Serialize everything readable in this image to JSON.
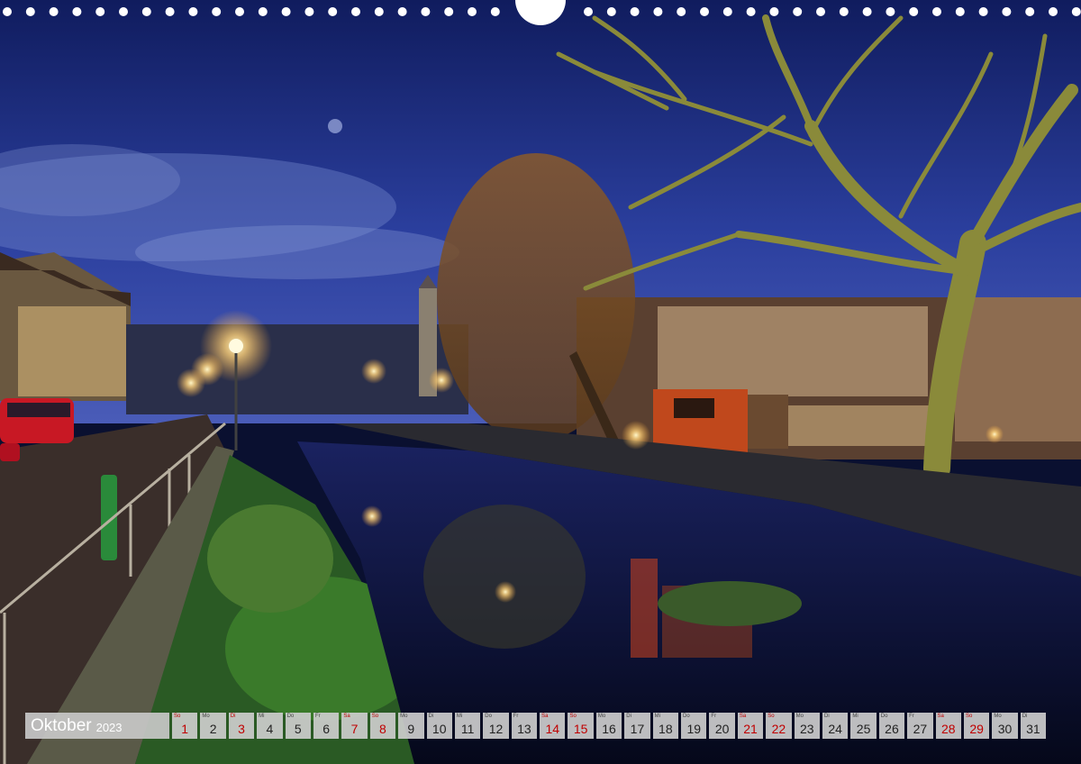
{
  "calendar": {
    "month": "Oktober",
    "year": "2023",
    "days": [
      {
        "wd": "So",
        "num": "1",
        "red": true
      },
      {
        "wd": "Mo",
        "num": "2",
        "red": false
      },
      {
        "wd": "Di",
        "num": "3",
        "red": true
      },
      {
        "wd": "Mi",
        "num": "4",
        "red": false
      },
      {
        "wd": "Do",
        "num": "5",
        "red": false
      },
      {
        "wd": "Fr",
        "num": "6",
        "red": false
      },
      {
        "wd": "Sa",
        "num": "7",
        "red": true
      },
      {
        "wd": "So",
        "num": "8",
        "red": true
      },
      {
        "wd": "Mo",
        "num": "9",
        "red": false
      },
      {
        "wd": "Di",
        "num": "10",
        "red": false
      },
      {
        "wd": "Mi",
        "num": "11",
        "red": false
      },
      {
        "wd": "Do",
        "num": "12",
        "red": false
      },
      {
        "wd": "Fr",
        "num": "13",
        "red": false
      },
      {
        "wd": "Sa",
        "num": "14",
        "red": true
      },
      {
        "wd": "So",
        "num": "15",
        "red": true
      },
      {
        "wd": "Mo",
        "num": "16",
        "red": false
      },
      {
        "wd": "Di",
        "num": "17",
        "red": false
      },
      {
        "wd": "Mi",
        "num": "18",
        "red": false
      },
      {
        "wd": "Do",
        "num": "19",
        "red": false
      },
      {
        "wd": "Fr",
        "num": "20",
        "red": false
      },
      {
        "wd": "Sa",
        "num": "21",
        "red": true
      },
      {
        "wd": "So",
        "num": "22",
        "red": true
      },
      {
        "wd": "Mo",
        "num": "23",
        "red": false
      },
      {
        "wd": "Di",
        "num": "24",
        "red": false
      },
      {
        "wd": "Mi",
        "num": "25",
        "red": false
      },
      {
        "wd": "Do",
        "num": "26",
        "red": false
      },
      {
        "wd": "Fr",
        "num": "27",
        "red": false
      },
      {
        "wd": "Sa",
        "num": "28",
        "red": true
      },
      {
        "wd": "So",
        "num": "29",
        "red": true
      },
      {
        "wd": "Mo",
        "num": "30",
        "red": false
      },
      {
        "wd": "Di",
        "num": "31",
        "red": false
      }
    ]
  },
  "photo": {
    "sign_text": "",
    "colors": {
      "sky_top": "#1a2a78",
      "sky_bottom": "#3a4fb0",
      "water": "#0a1030",
      "lamp": "#ffd27a",
      "red_kiosk": "#b8401a"
    }
  }
}
